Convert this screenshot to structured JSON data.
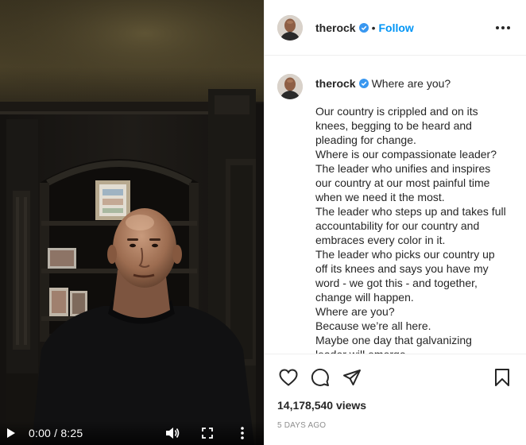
{
  "video": {
    "time_display": "0:00 / 8:25",
    "controls": {
      "play_icon": "play-icon",
      "volume_icon": "volume-icon",
      "fullscreen_icon": "fullscreen-icon",
      "menu_icon": "vertical-dots-icon"
    }
  },
  "header": {
    "username": "therock",
    "separator": "•",
    "follow_label": "Follow",
    "verified_icon": "verified-badge-icon",
    "more_icon": "more-options-icon"
  },
  "caption": {
    "username": "therock",
    "title": "Where are you?",
    "lines": [
      "Our country is crippled and on its",
      "knees, begging to be heard and",
      "pleading for change.",
      "Where is our compassionate leader?",
      "The leader who unifies and inspires",
      "our country at our most painful time",
      "when we need it the most.",
      "The leader who steps up and takes full",
      "accountability for our country and",
      "embraces every color in it.",
      "The leader who picks our country up",
      "off its knees and says you have my",
      "word - we got this - and together,",
      "change will happen.",
      "Where are you?",
      "Because we’re all here.",
      "Maybe one day that galvanizing",
      "leader will emerge."
    ]
  },
  "actions": {
    "like_icon": "heart-icon",
    "comment_icon": "comment-icon",
    "share_icon": "share-icon",
    "save_icon": "bookmark-icon"
  },
  "stats": {
    "views": "14,178,540 views",
    "timestamp": "5 DAYS AGO"
  },
  "colors": {
    "link_blue": "#0095f6",
    "verified_blue": "#3897f0",
    "text": "#262626",
    "muted": "#8e8e8e",
    "border": "#efefef"
  }
}
